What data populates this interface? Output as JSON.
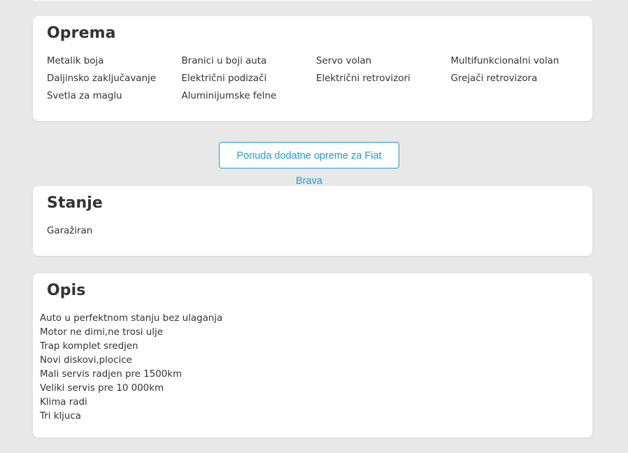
{
  "equipment": {
    "title": "Oprema",
    "items": [
      "Metalik boja",
      "Branici u boji auta",
      "Servo volan",
      "Multifunkcionalni volan",
      "Daljinsko zaključavanje",
      "Električni podizači",
      "Električni retrovizori",
      "Grejači retrovizora",
      "Svetla za maglu",
      "Aluminijumske felne"
    ]
  },
  "extra_equipment_button": {
    "label": "Ponuda dodatne opreme za Fiat Brava"
  },
  "condition": {
    "title": "Stanje",
    "value": "Garažiran"
  },
  "description": {
    "title": "Opis",
    "lines": [
      "Auto u perfektnom stanju bez ulaganja",
      "Motor ne dimi,ne trosi ulje",
      "Trap komplet sredjen",
      "Novi diskovi,plocice",
      "Mali servis radjen pre 1500km",
      "Veliki servis pre 10 000km",
      "Klima radi",
      "Tri kljuca"
    ]
  },
  "colors": {
    "page_background": "#e8e8e8",
    "card_background": "#ffffff",
    "text": "#333333",
    "accent": "#1a9ed4"
  }
}
